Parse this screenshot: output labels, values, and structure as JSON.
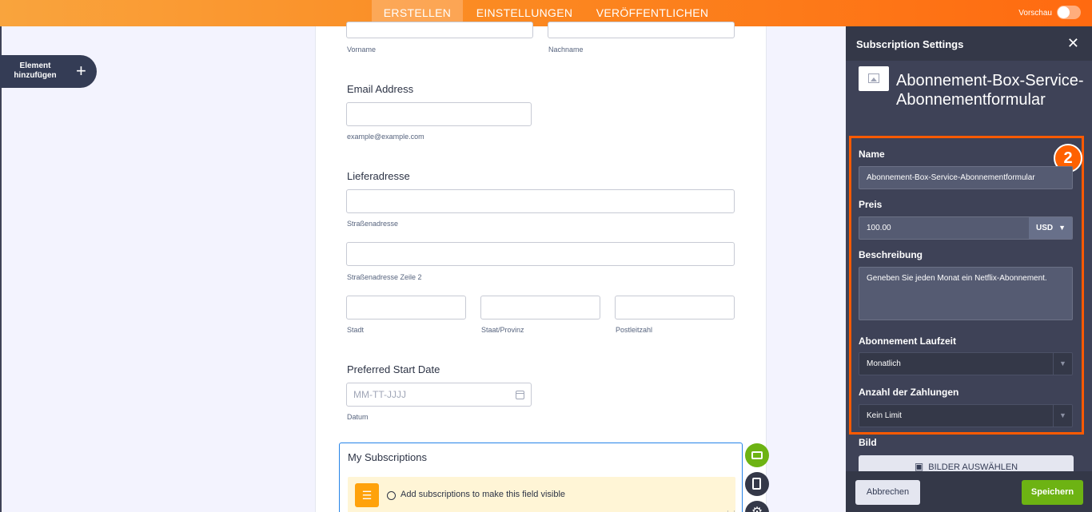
{
  "topbar": {
    "tabs": [
      {
        "label": "ERSTELLEN",
        "active": true
      },
      {
        "label": "EINSTELLUNGEN",
        "active": false
      },
      {
        "label": "VERÖFFENTLICHEN",
        "active": false
      }
    ],
    "preview_label": "Vorschau"
  },
  "sidebar": {
    "add_element": "Element hinzufügen"
  },
  "form": {
    "firstname_sub": "Vorname",
    "lastname_sub": "Nachname",
    "email_label": "Email Address",
    "email_sub": "example@example.com",
    "address_label": "Lieferadresse",
    "street_sub": "Straßenadresse",
    "street2_sub": "Straßenadresse Zeile 2",
    "city_sub": "Stadt",
    "state_sub": "Staat/Provinz",
    "zip_sub": "Postleitzahl",
    "start_date_label": "Preferred Start Date",
    "date_placeholder": "MM-TT-JJJJ",
    "date_sub": "Datum",
    "subscriptions_title": "My Subscriptions",
    "subscriptions_notice": "Add subscriptions to make this field visible"
  },
  "panel": {
    "title": "Subscription Settings",
    "product_name": "Abonnement-Box-Service-Abonnementformular",
    "step_badge": "2",
    "name_label": "Name",
    "name_value": "Abonnement-Box-Service-Abonnementformular",
    "price_label": "Preis",
    "price_value": "100.00",
    "currency": "USD",
    "description_label": "Beschreibung",
    "description_value": "Geneben Sie jeden Monat ein Netflix-Abonnement.",
    "duration_label": "Abonnement Laufzeit",
    "duration_value": "Monatlich",
    "payments_label": "Anzahl der Zahlungen",
    "payments_value": "Kein Limit",
    "image_label": "Bild",
    "image_button": "BILDER AUSWÄHLEN",
    "cancel_button": "Abbrechen",
    "save_button": "Speichern"
  },
  "colors": {
    "accent_orange": "#ff6a10",
    "highlight": "#ff5a00",
    "save_green": "#6db313",
    "panel_bg": "#3e4257"
  }
}
